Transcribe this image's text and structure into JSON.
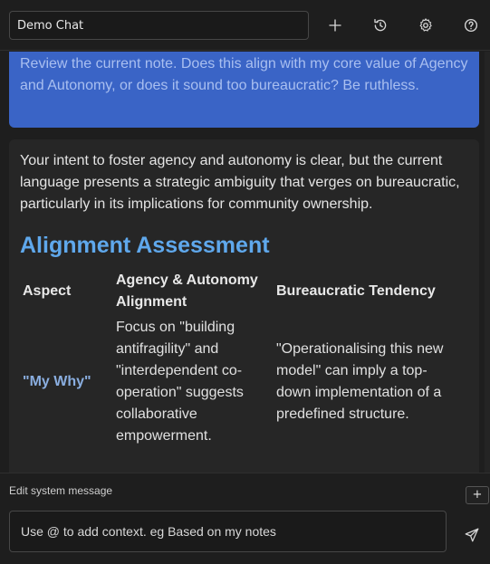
{
  "header": {
    "chat_title": "Demo Chat",
    "icons": [
      "plus-icon",
      "history-icon",
      "gear-icon",
      "help-icon"
    ]
  },
  "messages": {
    "user": {
      "text": "Review the current note. Does this align with my core value of Agency and Autonomy, or does it sound too bureaucratic? Be ruthless."
    },
    "assistant": {
      "intro": "Your intent to foster agency and autonomy is clear, but the current language presents a strategic ambiguity that verges on bureaucratic, particularly in its implications for community ownership.",
      "heading": "Alignment Assessment",
      "table": {
        "headers": [
          "Aspect",
          "Agency & Autonomy Alignment",
          "Bureaucratic Tendency"
        ],
        "rows": [
          {
            "aspect": "\"My Why\"",
            "alignment": "Focus on \"building antifragility\" and \"interdependent co-operation\" suggests collaborative empowerment.",
            "bureaucratic": "\"Operationalising this new model\" can imply a top-down implementation of a predefined structure."
          }
        ]
      }
    }
  },
  "composer": {
    "system_message_label": "Edit system message",
    "add_label": "+",
    "input_placeholder": "Use @ to add context. eg Based on my notes",
    "input_value": ""
  },
  "colors": {
    "background": "#1e1e1e",
    "user_bubble": "#3a64c6",
    "assistant_bubble": "#262626",
    "heading_accent": "#5fa8ec"
  }
}
